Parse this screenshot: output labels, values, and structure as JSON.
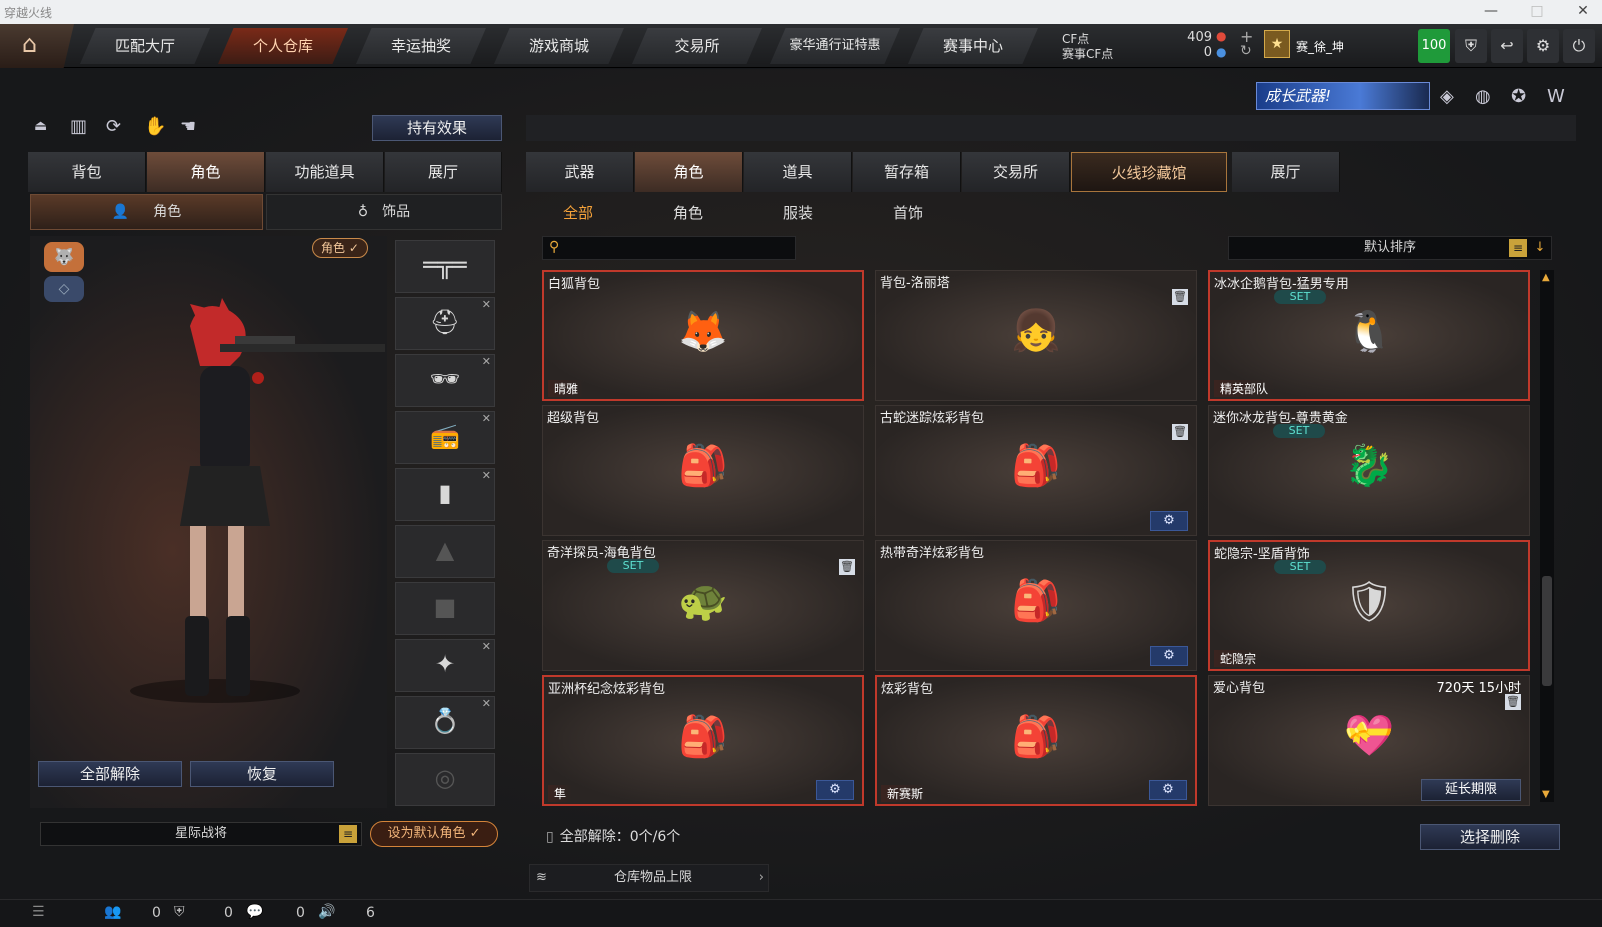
{
  "window": {
    "title": "穿越火线"
  },
  "nav": {
    "items": [
      "匹配大厅",
      "个人仓库",
      "幸运抽奖",
      "游戏商城",
      "交易所",
      "豪华通行证特惠",
      "赛事中心"
    ],
    "active": 1
  },
  "currency": {
    "cf_label": "CF点",
    "cf_value": "409",
    "match_label": "赛事CF点",
    "match_value": "0"
  },
  "player": {
    "name": "赛_徐_坤",
    "level": "100"
  },
  "banner": {
    "text": "成长武器!"
  },
  "left": {
    "effect_button": "持有效果",
    "tabs": [
      "背包",
      "角色",
      "功能道具",
      "展厅"
    ],
    "active_tab": 1,
    "subtabs": [
      "角色",
      "饰品"
    ],
    "role_badge": "角色 ✓",
    "unequip_all": "全部解除",
    "restore": "恢复",
    "role_name": "星际战将",
    "set_default": "设为默认角色"
  },
  "right": {
    "tabs": [
      "武器",
      "角色",
      "道具",
      "暂存箱",
      "交易所",
      "火线珍藏馆",
      "展厅"
    ],
    "active_tab": 1,
    "subtabs": [
      "全部",
      "角色",
      "服装",
      "首饰"
    ],
    "search_placeholder": "",
    "sort_label": "默认排序",
    "items": [
      {
        "name": "白狐背包",
        "tag": "晴雅",
        "set": "",
        "time": "",
        "red": true,
        "icon": "🦊",
        "gear": false,
        "trash": false,
        "extend": ""
      },
      {
        "name": "背包-洛丽塔",
        "tag": "",
        "set": "",
        "time": "",
        "red": false,
        "icon": "👧",
        "gear": false,
        "trash": true,
        "extend": ""
      },
      {
        "name": "冰冰企鹅背包-猛男专用",
        "tag": "精英部队",
        "set": "SET",
        "time": "",
        "red": true,
        "icon": "🐧",
        "gear": false,
        "trash": false,
        "extend": ""
      },
      {
        "name": "超级背包",
        "tag": "",
        "set": "",
        "time": "",
        "red": false,
        "icon": "🎒",
        "gear": false,
        "trash": false,
        "extend": ""
      },
      {
        "name": "古蛇迷踪炫彩背包",
        "tag": "",
        "set": "",
        "time": "",
        "red": false,
        "icon": "🎒",
        "gear": true,
        "trash": true,
        "extend": ""
      },
      {
        "name": "迷你冰龙背包-尊贵黄金",
        "tag": "",
        "set": "SET",
        "time": "",
        "red": false,
        "icon": "🐉",
        "gear": false,
        "trash": false,
        "extend": ""
      },
      {
        "name": "奇洋探员-海龟背包",
        "tag": "",
        "set": "SET",
        "time": "",
        "red": false,
        "icon": "🐢",
        "gear": false,
        "trash": true,
        "extend": ""
      },
      {
        "name": "热带奇洋炫彩背包",
        "tag": "",
        "set": "",
        "time": "",
        "red": false,
        "icon": "🎒",
        "gear": true,
        "trash": false,
        "extend": ""
      },
      {
        "name": "蛇隐宗-坚盾背饰",
        "tag": "蛇隐宗",
        "set": "SET",
        "time": "",
        "red": true,
        "icon": "🛡",
        "gear": false,
        "trash": false,
        "extend": ""
      },
      {
        "name": "亚洲杯纪念炫彩背包",
        "tag": "隼",
        "set": "",
        "time": "",
        "red": true,
        "icon": "🎒",
        "gear": true,
        "trash": false,
        "extend": ""
      },
      {
        "name": "炫彩背包",
        "tag": "新赛斯",
        "set": "",
        "time": "",
        "red": true,
        "icon": "🎒",
        "gear": true,
        "trash": false,
        "extend": ""
      },
      {
        "name": "爱心背包",
        "tag": "",
        "set": "",
        "time": "720天 15小时",
        "red": false,
        "icon": "💝",
        "gear": false,
        "trash": true,
        "extend": "延长期限"
      }
    ],
    "unequip_count": "全部解除：0个/6个",
    "select_delete": "选择删除",
    "storage_limit": "仓库物品上限"
  },
  "status": {
    "c1": "0",
    "c2": "0",
    "c3": "0",
    "c4": "6"
  },
  "colors": {
    "accent": "#f5a23a",
    "alert": "#c0392b",
    "level_green": "#1f9a3a"
  }
}
